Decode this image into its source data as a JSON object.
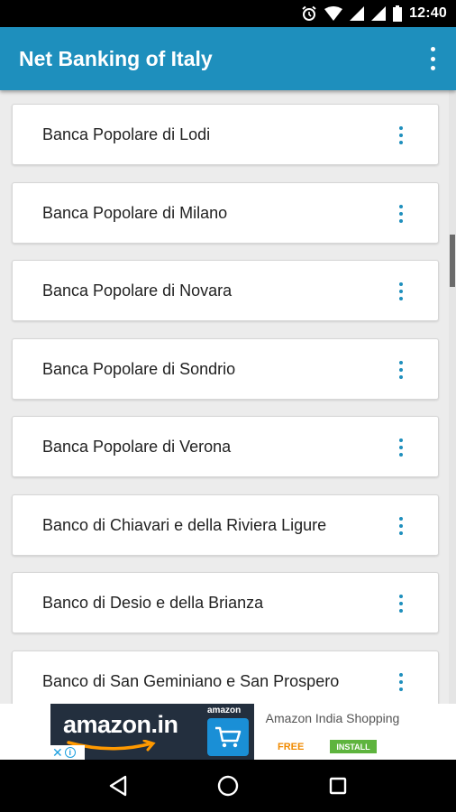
{
  "status_bar": {
    "time": "12:40",
    "icons": [
      "alarm-icon",
      "wifi-icon",
      "signal-icon",
      "signal-icon",
      "battery-icon"
    ]
  },
  "app_bar": {
    "title": "Net Banking of Italy",
    "overflow_icon": "more-vert-icon"
  },
  "colors": {
    "primary": "#1e8fbd",
    "status_bar": "#000000",
    "card_background": "#ffffff",
    "list_background": "#ececec"
  },
  "banks": [
    "Banca Popolare di Lodi",
    "Banca Popolare di Milano",
    "Banca Popolare di Novara",
    "Banca Popolare di Sondrio",
    "Banca Popolare di Verona",
    "Banco di Chiavari e della Riviera Ligure",
    "Banco di Desio e della Brianza",
    "Banco di San Geminiano e San Prospero"
  ],
  "ad": {
    "brand": "amazon.in",
    "cart_brand": "amazon",
    "title": "Amazon India Shopping",
    "free": "FREE",
    "install": "INSTALL"
  },
  "nav_bar": {
    "icons": [
      "back-icon",
      "home-icon",
      "recents-icon"
    ]
  }
}
